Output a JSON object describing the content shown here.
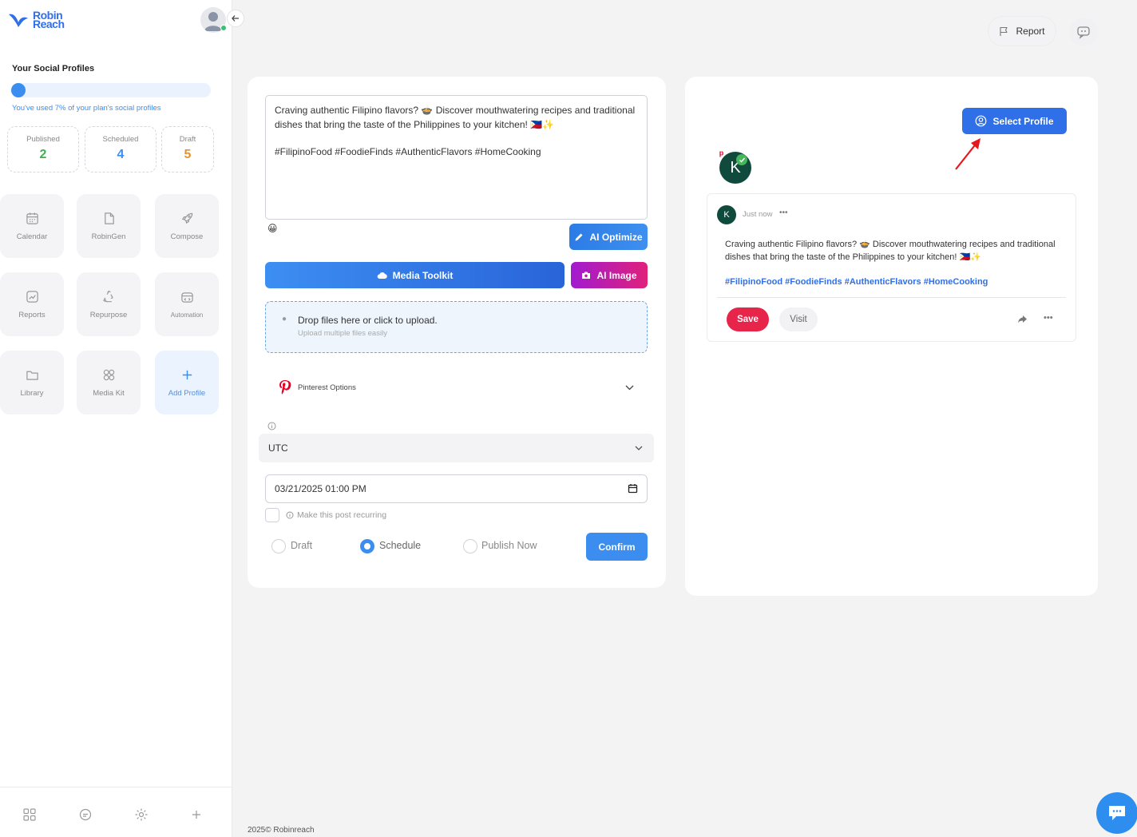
{
  "brand": {
    "line1": "Robin",
    "line2": "Reach"
  },
  "sidebar": {
    "profiles_title": "Your Social Profiles",
    "usage_percent": 7,
    "usage_note": "You've used 7% of your plan's social profiles",
    "stats": [
      {
        "label": "Published",
        "value": "2",
        "color": "#3cb050"
      },
      {
        "label": "Scheduled",
        "value": "4",
        "color": "#3b8ef0"
      },
      {
        "label": "Draft",
        "value": "5",
        "color": "#e8932a"
      }
    ],
    "tiles": [
      {
        "label": "Calendar",
        "icon": "calendar-icon"
      },
      {
        "label": "RobinGen",
        "icon": "document-icon"
      },
      {
        "label": "Compose",
        "icon": "rocket-icon"
      },
      {
        "label": "Reports",
        "icon": "chart-icon"
      },
      {
        "label": "Repurpose",
        "icon": "recycle-icon"
      },
      {
        "label": "Automation",
        "icon": "automation-icon"
      },
      {
        "label": "Library",
        "icon": "folder-icon"
      },
      {
        "label": "Media Kit",
        "icon": "grid-icon"
      },
      {
        "label": "Add Profile",
        "icon": "plus-icon"
      }
    ]
  },
  "topbar": {
    "report_label": "Report"
  },
  "compose": {
    "text_line1": "Craving authentic Filipino flavors? 🍲 Discover mouthwatering recipes and traditional dishes that bring the taste of the Philippines to your kitchen! 🇵🇭✨",
    "text_line2": "#FilipinoFood #FoodieFinds #AuthenticFlavors #HomeCooking",
    "ai_optimize_label": "AI Optimize",
    "media_toolkit_label": "Media Toolkit",
    "ai_image_label": "AI Image",
    "dropzone_title": "Drop files here or click to upload.",
    "dropzone_subtitle": "Upload multiple files easily",
    "pinterest_options_label": "Pinterest Options",
    "timezone": "UTC",
    "datetime": "03/21/2025 01:00 PM",
    "recurring_label": "Make this post recurring",
    "options": [
      {
        "label": "Draft",
        "selected": false
      },
      {
        "label": "Schedule",
        "selected": true
      },
      {
        "label": "Publish Now",
        "selected": false
      }
    ],
    "confirm_label": "Confirm"
  },
  "preview": {
    "select_profile_label": "Select Profile",
    "avatar_letter": "K",
    "post_time": "Just now",
    "post_text": "Craving authentic Filipino flavors? 🍲 Discover mouthwatering recipes and traditional dishes that bring the taste of the Philippines to your kitchen! 🇵🇭✨",
    "post_tags": "#FilipinoFood #FoodieFinds #AuthenticFlavors #HomeCooking",
    "save_label": "Save",
    "visit_label": "Visit"
  },
  "footer": {
    "copyright": "2025© Robinreach"
  },
  "colors": {
    "primary": "#2f6fe8",
    "accent": "#3b8ef0",
    "pinterest": "#e60023"
  }
}
